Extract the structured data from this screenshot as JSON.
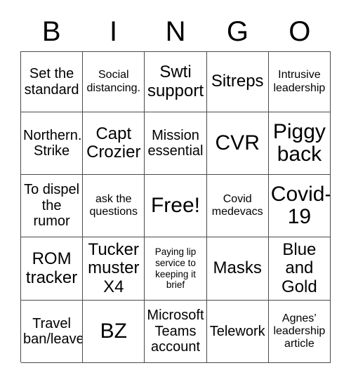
{
  "card": {
    "type": "bingo-card",
    "header_letters": [
      "B",
      "I",
      "N",
      "G",
      "O"
    ],
    "columns": 5,
    "rows": 5,
    "colors": {
      "background": "#ffffff",
      "text": "#000000",
      "grid_line": "#4a4a4a"
    },
    "cells": [
      {
        "text": "Set the standard",
        "size": "md",
        "row": 1,
        "col": 1
      },
      {
        "text": "Social distancing.",
        "size": "sm",
        "row": 1,
        "col": 2
      },
      {
        "text": "Swti support",
        "size": "lg",
        "row": 1,
        "col": 3
      },
      {
        "text": "Sitreps",
        "size": "lg",
        "row": 1,
        "col": 4
      },
      {
        "text": "Intrusive leadership",
        "size": "sm",
        "row": 1,
        "col": 5
      },
      {
        "text": "Northern. Strike",
        "size": "md",
        "row": 2,
        "col": 1
      },
      {
        "text": "Capt Crozier",
        "size": "lg",
        "row": 2,
        "col": 2
      },
      {
        "text": "Mission essential",
        "size": "md",
        "row": 2,
        "col": 3
      },
      {
        "text": "CVR",
        "size": "xl",
        "row": 2,
        "col": 4
      },
      {
        "text": "Piggy back",
        "size": "xl",
        "row": 2,
        "col": 5
      },
      {
        "text": "To dispel the rumor",
        "size": "md",
        "row": 3,
        "col": 1
      },
      {
        "text": "ask the questions",
        "size": "sm",
        "row": 3,
        "col": 2
      },
      {
        "text": "Free!",
        "size": "xl",
        "row": 3,
        "col": 3
      },
      {
        "text": "Covid medevacs",
        "size": "sm",
        "row": 3,
        "col": 4
      },
      {
        "text": "Covid-19",
        "size": "xl",
        "row": 3,
        "col": 5
      },
      {
        "text": "ROM tracker",
        "size": "lg",
        "row": 4,
        "col": 1
      },
      {
        "text": "Tucker muster X4",
        "size": "lg",
        "row": 4,
        "col": 2
      },
      {
        "text": "Paying lip service to keeping it brief",
        "size": "xs",
        "row": 4,
        "col": 3
      },
      {
        "text": "Masks",
        "size": "lg",
        "row": 4,
        "col": 4
      },
      {
        "text": "Blue and Gold",
        "size": "lg",
        "row": 4,
        "col": 5
      },
      {
        "text": "Travel ban/leave",
        "size": "md",
        "row": 5,
        "col": 1
      },
      {
        "text": "BZ",
        "size": "xl",
        "row": 5,
        "col": 2
      },
      {
        "text": "Microsoft Teams account",
        "size": "md",
        "row": 5,
        "col": 3
      },
      {
        "text": "Telework",
        "size": "md",
        "row": 5,
        "col": 4
      },
      {
        "text": "Agnes’ leadership article",
        "size": "sm",
        "row": 5,
        "col": 5
      }
    ]
  }
}
